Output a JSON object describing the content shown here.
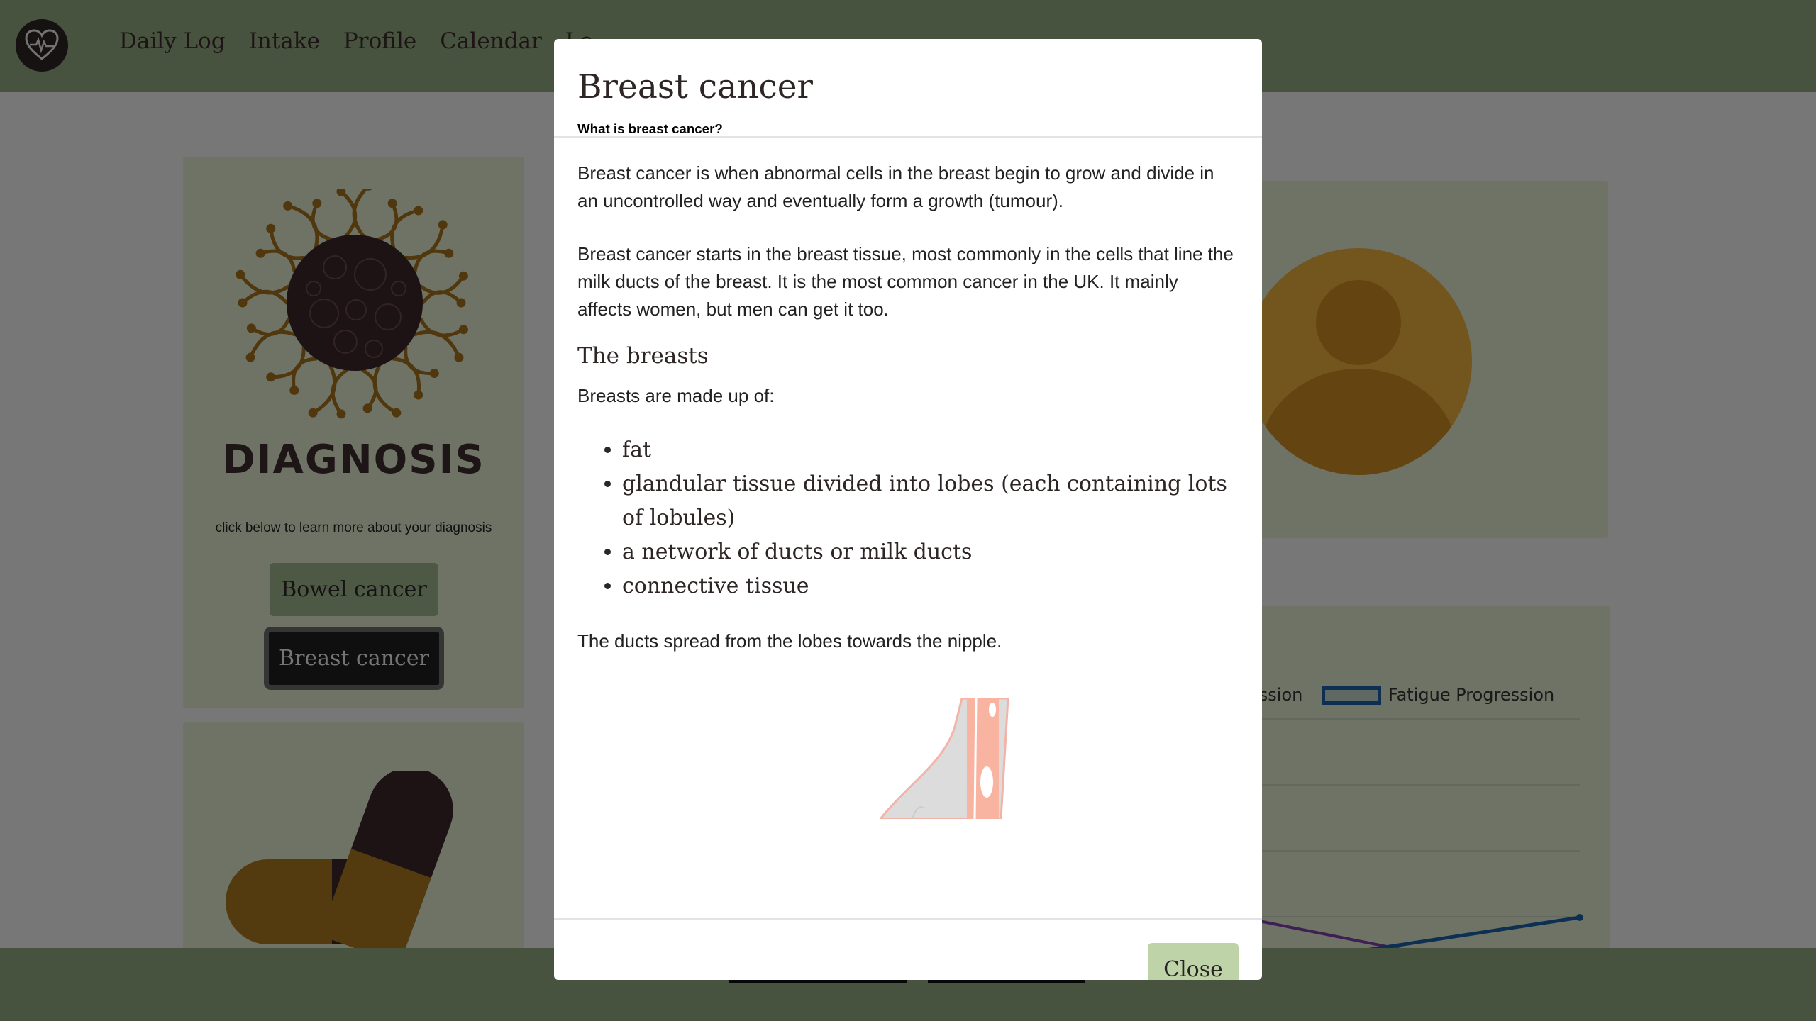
{
  "nav": {
    "links": [
      "Daily Log",
      "Intake",
      "Profile",
      "Calendar",
      "Lo"
    ]
  },
  "diagnosis": {
    "title": "DIAGNOSIS",
    "subtitle": "click below to learn more about your diagnosis",
    "buttons": [
      "Bowel cancer",
      "Breast cancer"
    ]
  },
  "chart": {
    "legend_partial": "ession",
    "legend_fatigue": "Fatigue Progression",
    "colors": {
      "fatigue": "#1a5fa5",
      "other": "#7d3fa6"
    }
  },
  "modal": {
    "title": "Breast cancer",
    "heading_what": "What is breast cancer?",
    "para_1": "Breast cancer is when abnormal cells in the breast begin to grow and divide in an uncontrolled way and eventually form a growth (tumour).",
    "para_2": "Breast cancer starts in the breast tissue, most commonly in the cells that line the milk ducts of the breast. It is the most common cancer in the UK. It mainly affects women, but men can get it too.",
    "heading_breasts": "The breasts",
    "para_3": "Breasts are made up of:",
    "list": [
      "fat",
      "glandular tissue divided into lobes (each containing lots of lobules)",
      "a network of ducts or milk ducts",
      "connective tissue"
    ],
    "para_4": "The ducts spread from the lobes towards the nipple.",
    "close_label": "Close"
  },
  "colors": {
    "navbar": "#8fa57f",
    "card": "#dce6cd",
    "accent_button": "#bfd3a8",
    "dark_text": "#2e2525"
  }
}
